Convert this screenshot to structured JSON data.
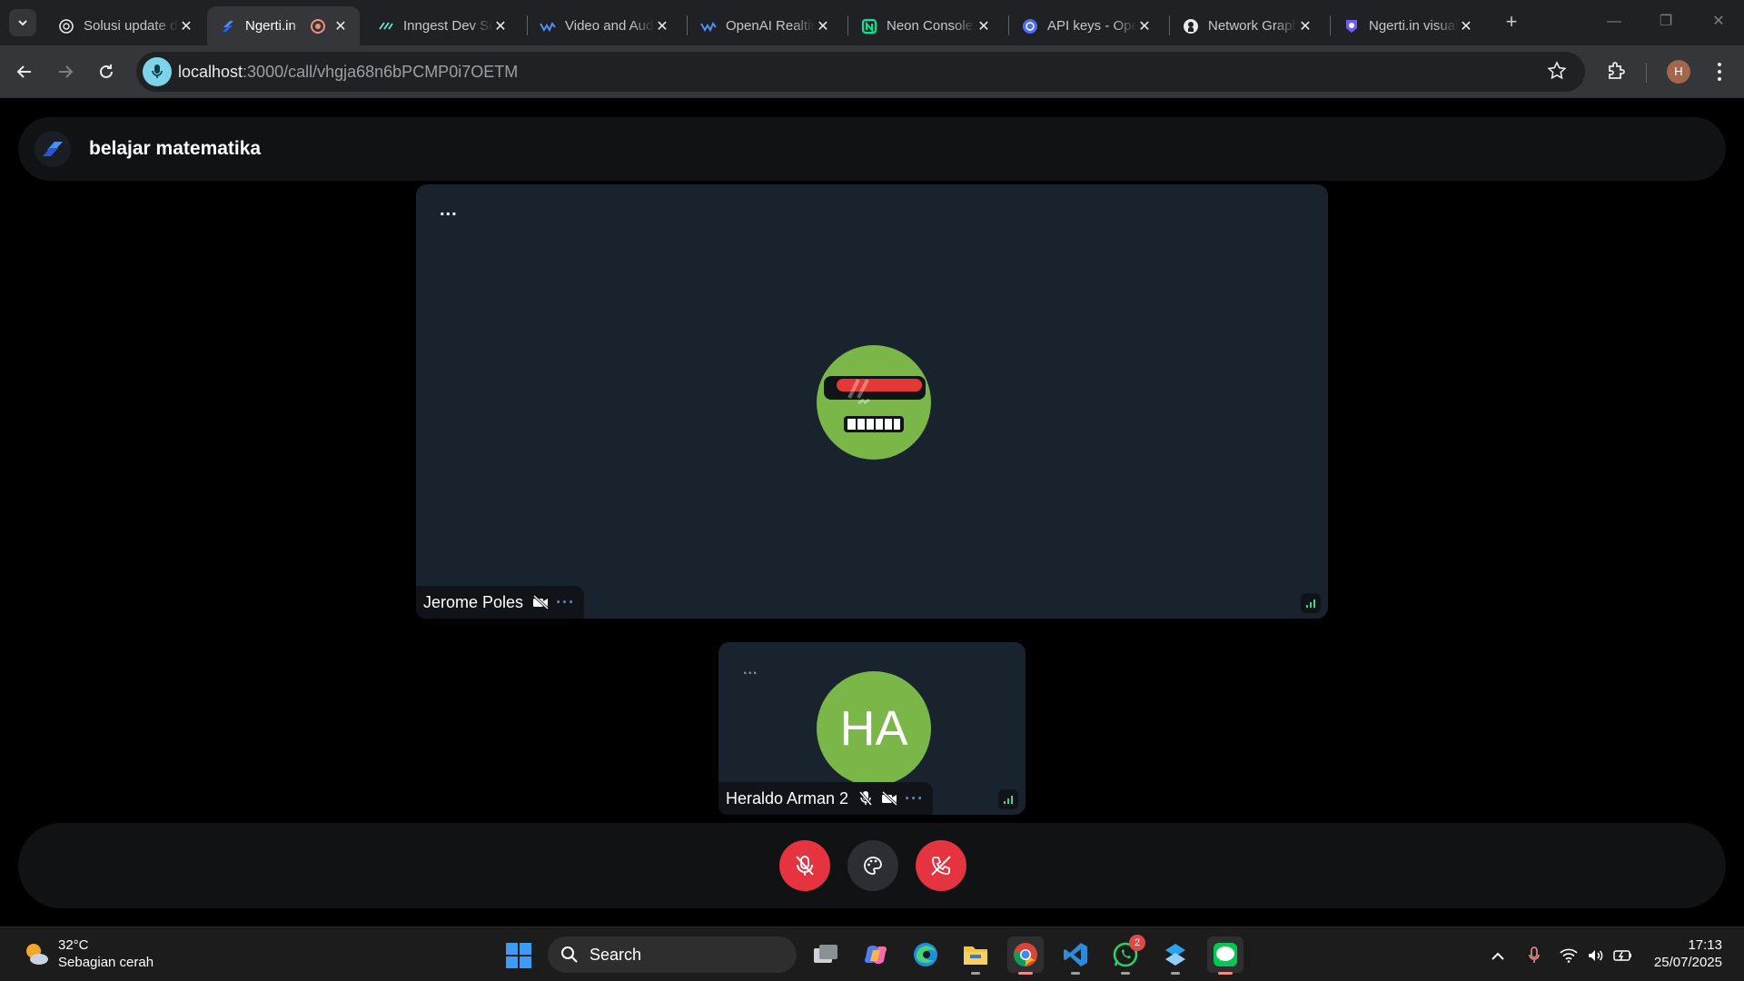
{
  "browser": {
    "tabs": [
      {
        "title": "Solusi update database",
        "icon": "chatgpt-icon",
        "active": false
      },
      {
        "title": "Ngerti.in",
        "icon": "ngertiin-icon",
        "active": true
      },
      {
        "title": "Inngest Dev Server",
        "icon": "inngest-icon",
        "active": false
      },
      {
        "title": "Video and Audio",
        "icon": "stream-icon",
        "active": false
      },
      {
        "title": "OpenAI Realtime",
        "icon": "stream-icon",
        "active": false
      },
      {
        "title": "Neon Console",
        "icon": "neon-icon",
        "active": false
      },
      {
        "title": "API keys - OpenAI",
        "icon": "openai-icon",
        "active": false
      },
      {
        "title": "Network Graph",
        "icon": "github-icon",
        "active": false
      },
      {
        "title": "Ngerti.in visual",
        "icon": "ngertiin-shield-icon",
        "active": false
      }
    ],
    "url": {
      "host": "localhost",
      "path": ":3000/call/vhgja68n6bPCMP0i7OETM"
    },
    "profile_initial": "H"
  },
  "page": {
    "meeting_title": "belajar matematika",
    "participants": [
      {
        "name": "Jerome Poles",
        "avatar": "robot-avatar"
      },
      {
        "name": "Heraldo Arman 2",
        "initials": "HA"
      }
    ],
    "tile_menu_label": "...",
    "pill_menu_label": "···"
  },
  "taskbar": {
    "weather": {
      "temperature": "32°C",
      "condition": "Sebagian cerah"
    },
    "search_placeholder": "Search",
    "whatsapp_badge": "2",
    "clock": {
      "time": "17:13",
      "date": "25/07/2025"
    }
  },
  "colors": {
    "tile_bg": "#19232d",
    "avatar_green": "#7ab648",
    "danger_red": "#e5333f",
    "signal_green": "#3dd68c",
    "accent_blue": "#4c8df6"
  }
}
